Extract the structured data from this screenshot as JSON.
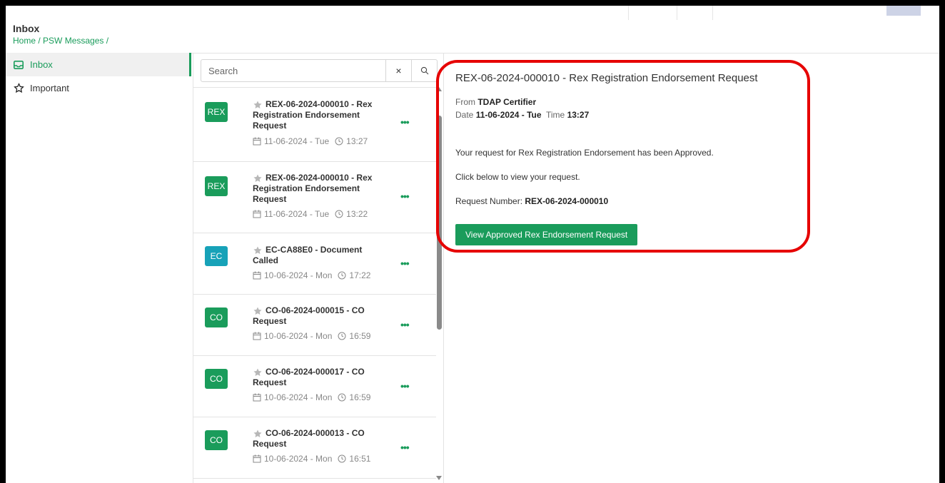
{
  "header": {
    "title": "Inbox",
    "breadcrumb": [
      "Home",
      "PSW Messages"
    ]
  },
  "sidebar": {
    "items": [
      {
        "label": "Inbox",
        "icon": "inbox-icon",
        "active": true
      },
      {
        "label": "Important",
        "icon": "star-outline-icon",
        "active": false
      }
    ]
  },
  "search": {
    "placeholder": "Search",
    "clear_symbol": "×"
  },
  "messages": [
    {
      "badge": "REX",
      "badge_color": "#1a9c5b",
      "subject": "REX-06-2024-000010 - Rex Registration Endorsement Request",
      "date": "11-06-2024 - Tue",
      "time": "13:27"
    },
    {
      "badge": "REX",
      "badge_color": "#1a9c5b",
      "subject": "REX-06-2024-000010 - Rex Registration Endorsement Request",
      "date": "11-06-2024 - Tue",
      "time": "13:22"
    },
    {
      "badge": "EC",
      "badge_color": "#17a2b8",
      "subject": "EC-CA88E0 - Document Called",
      "date": "10-06-2024 - Mon",
      "time": "17:22"
    },
    {
      "badge": "CO",
      "badge_color": "#1a9c5b",
      "subject": "CO-06-2024-000015 - CO Request",
      "date": "10-06-2024 - Mon",
      "time": "16:59"
    },
    {
      "badge": "CO",
      "badge_color": "#1a9c5b",
      "subject": "CO-06-2024-000017 - CO Request",
      "date": "10-06-2024 - Mon",
      "time": "16:59"
    },
    {
      "badge": "CO",
      "badge_color": "#1a9c5b",
      "subject": "CO-06-2024-000013 - CO Request",
      "date": "10-06-2024 - Mon",
      "time": "16:51"
    }
  ],
  "detail": {
    "title": "REX-06-2024-000010 - Rex Registration Endorsement Request",
    "from_label": "From",
    "from_value": "TDAP Certifier",
    "date_label": "Date",
    "date_value": "11-06-2024 - Tue",
    "time_label": "Time",
    "time_value": "13:27",
    "body_line1": "Your request for Rex Registration Endorsement has been Approved.",
    "body_line2": "Click below to view your request.",
    "request_label": "Request Number:",
    "request_value": "REX-06-2024-000010",
    "button_label": "View Approved Rex Endorsement Request"
  },
  "colors": {
    "accent": "#1a9c5b",
    "highlight": "#e60000"
  }
}
